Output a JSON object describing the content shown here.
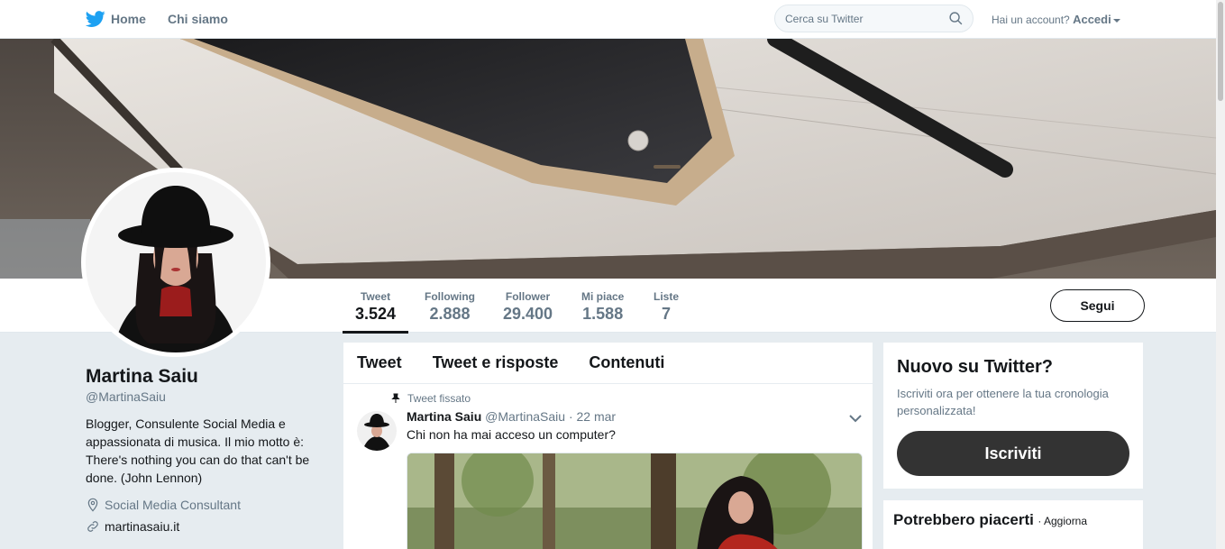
{
  "nav": {
    "home_label": "Home",
    "about_label": "Chi siamo",
    "search_placeholder": "Cerca su Twitter",
    "account_prompt": "Hai un account?",
    "login_label": "Accedi"
  },
  "profile_nav": {
    "stats": [
      {
        "label": "Tweet",
        "value": "3.524"
      },
      {
        "label": "Following",
        "value": "2.888"
      },
      {
        "label": "Follower",
        "value": "29.400"
      },
      {
        "label": "Mi piace",
        "value": "1.588"
      },
      {
        "label": "Liste",
        "value": "7"
      }
    ],
    "follow_label": "Segui"
  },
  "profile": {
    "name": "Martina Saiu",
    "handle": "@MartinaSaiu",
    "bio": "Blogger, Consulente Social Media e appassionata di musica. Il mio motto è: There's nothing you can do that can't be done. (John Lennon)",
    "location": "Social Media Consultant",
    "website": "martinasaiu.it"
  },
  "timeline": {
    "tabs": [
      "Tweet",
      "Tweet e risposte",
      "Contenuti"
    ],
    "pinned_label": "Tweet fissato",
    "tweet": {
      "author": "Martina Saiu",
      "handle": "@MartinaSaiu",
      "date": "· 22 mar",
      "text": "Chi non ha mai acceso un computer?"
    }
  },
  "sidebar": {
    "signup_title": "Nuovo su Twitter?",
    "signup_text": "Iscriviti ora per ottenere la tua cronologia personalizzata!",
    "signup_button": "Iscriviti",
    "suggest_title": "Potrebbero piacerti",
    "suggest_refresh": "· Aggiorna"
  },
  "colors": {
    "accent": "#1da1f2",
    "text": "#14171a",
    "muted": "#657786",
    "background": "#e6ecf0"
  }
}
